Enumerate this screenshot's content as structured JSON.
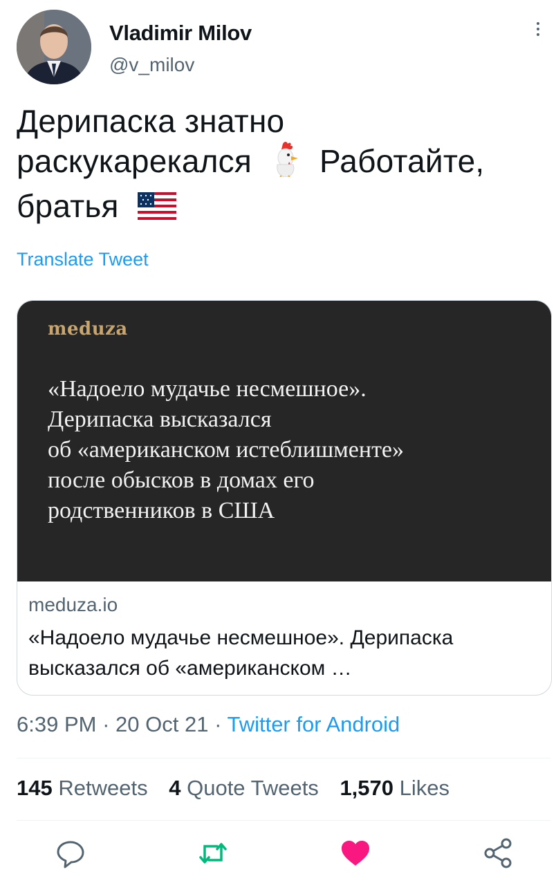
{
  "author": {
    "name": "Vladimir Milov",
    "handle": "@v_milov"
  },
  "tweet": {
    "line1": "Дерипаска знатно",
    "line2": "раскукарекался",
    "line2b": "Работайте,",
    "line3": "братья",
    "emoji_1": "rooster",
    "emoji_2": "us-flag",
    "translate_label": "Translate Tweet"
  },
  "card": {
    "logo_text": "meduza",
    "image_headline": "«Надоело мудачье несмешное».\nДерипаска высказался\nоб «американском истеблишменте»\nпосле обысков в домах его\nродственников в США",
    "domain": "meduza.io",
    "title": "«Надоело мудачье несмешное». Дерипаска высказался об «американском …"
  },
  "meta": {
    "time": "6:39 PM",
    "date": "20 Oct 21",
    "separator": "·",
    "source": "Twitter for Android"
  },
  "stats": {
    "retweets_count": "145",
    "retweets_label": "Retweets",
    "quotes_count": "4",
    "quotes_label": "Quote Tweets",
    "likes_count": "1,570",
    "likes_label": "Likes"
  },
  "colors": {
    "link_blue": "#1d9bf0",
    "retweet_green": "#00ba7c",
    "like_pink": "#f91880",
    "secondary_text": "#536471",
    "card_bg": "#262626"
  },
  "actions": [
    "reply-icon",
    "retweet-icon",
    "like-icon",
    "share-icon"
  ]
}
